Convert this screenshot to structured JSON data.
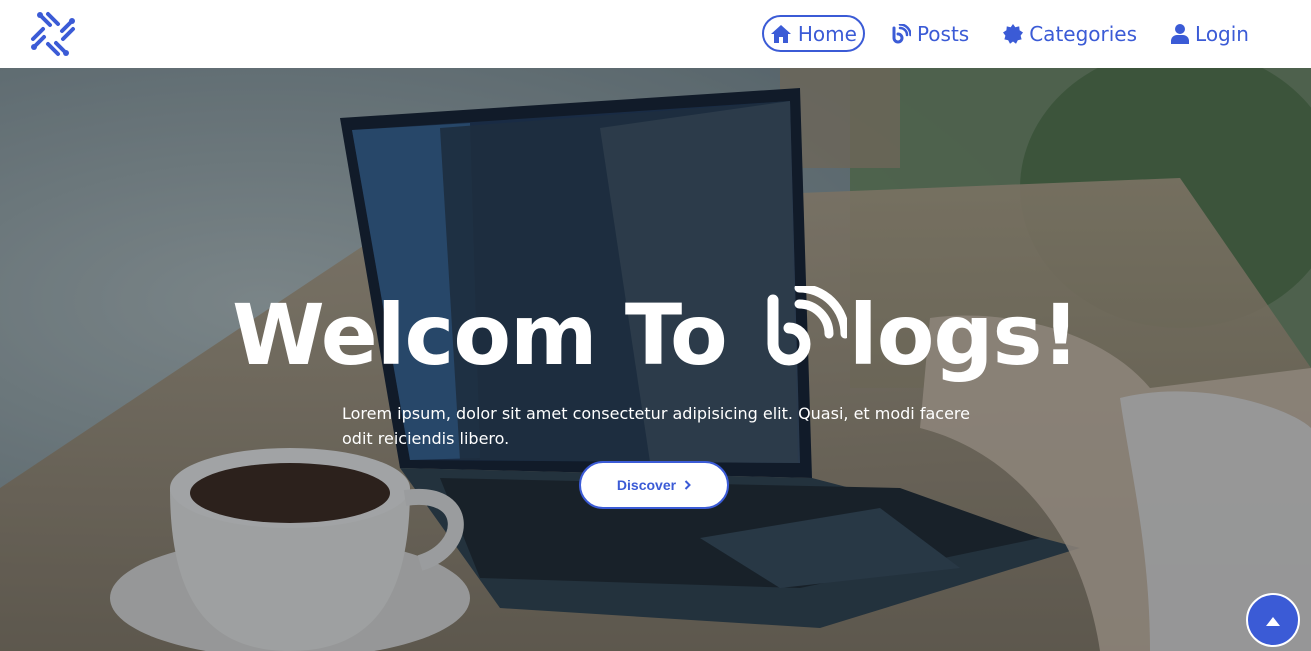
{
  "nav": {
    "logo_icon": "network-logo-icon",
    "items": [
      {
        "label": "Home",
        "icon": "home-icon",
        "active": true
      },
      {
        "label": "Posts",
        "icon": "blog-icon",
        "active": false
      },
      {
        "label": "Categories",
        "icon": "badge-icon",
        "active": false
      },
      {
        "label": "Login",
        "icon": "user-icon",
        "active": false
      }
    ]
  },
  "hero": {
    "title_before": "Welcom To ",
    "title_after": "logs!",
    "title_glyph": "blog-icon",
    "subtitle": "Lorem ipsum, dolor sit amet consectetur adipisicing elit. Quasi, et modi facere odit reiciendis libero.",
    "cta_label": "Discover",
    "cta_icon": "chevron-right-icon"
  },
  "scroll_top_icon": "caret-up-icon",
  "colors": {
    "accent": "#3b5bd6",
    "nav_bg": "#ffffff",
    "hero_text": "#ffffff"
  }
}
